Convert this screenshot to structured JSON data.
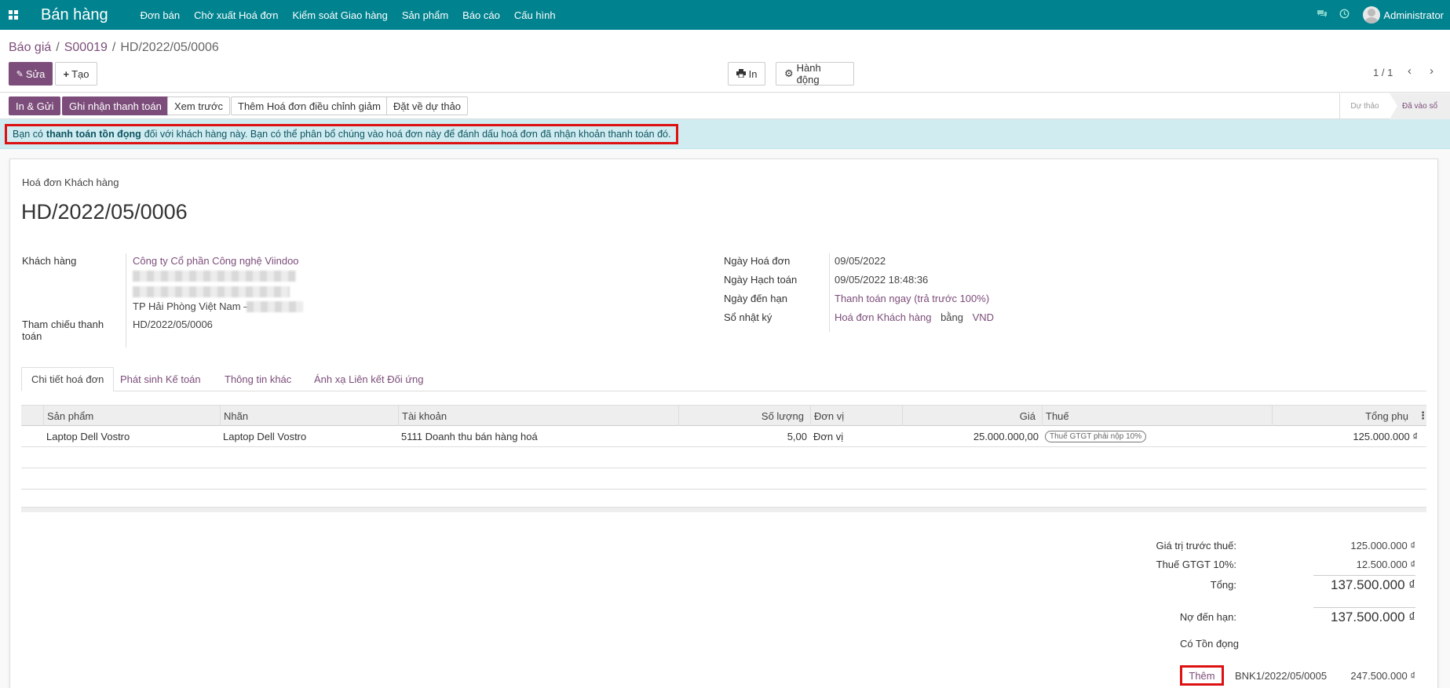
{
  "nav": {
    "brand": "Bán hàng",
    "menu": [
      "Đơn bán",
      "Chờ xuất Hoá đơn",
      "Kiểm soát Giao hàng",
      "Sản phẩm",
      "Báo cáo",
      "Cấu hình"
    ],
    "user": "Administrator"
  },
  "breadcrumb": [
    "Báo giá",
    "S00019",
    "HD/2022/05/0006"
  ],
  "toolbar": {
    "edit": "Sửa",
    "create": "Tạo",
    "print": "In",
    "action": "Hành động",
    "pager": "1 / 1"
  },
  "status_buttons": [
    "In & Gửi",
    "Ghi nhận thanh toán",
    "Xem trước",
    "Thêm Hoá đơn điều chỉnh giảm",
    "Đặt về dự thảo"
  ],
  "stages": {
    "draft": "Dự thảo",
    "posted": "Đã vào sổ"
  },
  "alert": {
    "before": "Bạn có",
    "bold": "thanh toán tồn đọng",
    "after": "đối với khách hàng này. Bạn có thể phân bổ chúng vào hoá đơn này để đánh dấu hoá đơn đã nhận khoản thanh toán đó."
  },
  "invoice": {
    "type": "Hoá đơn Khách hàng",
    "name": "HD/2022/05/0006",
    "customer_label": "Khách hàng",
    "customer": "Công ty Cổ phần Công nghệ Viindoo",
    "address_city": "TP Hải Phòng Việt Nam –",
    "payment_ref_label_1": "Tham chiếu thanh",
    "payment_ref_label_2": "toán",
    "payment_ref": "HD/2022/05/0006",
    "invoice_date_label": "Ngày Hoá đơn",
    "invoice_date": "09/05/2022",
    "accounting_date_label": "Ngày Hạch toán",
    "accounting_date": "09/05/2022 18:48:36",
    "due_date_label": "Ngày đến hạn",
    "due_date": "Thanh toán ngay (trả trước 100%)",
    "journal_label": "Sổ nhật ký",
    "journal": "Hoá đơn Khách hàng",
    "journal_in": "bằng",
    "currency": "VND"
  },
  "tabs": [
    "Chi tiết hoá đơn",
    "Phát sinh Kế toán",
    "Thông tin khác",
    "Ánh xạ Liên kết Đối ứng"
  ],
  "lines": {
    "headers": [
      "Sản phẩm",
      "Nhãn",
      "Tài khoản",
      "Số lượng",
      "Đơn vị",
      "Giá",
      "Thuế",
      "Tổng phụ"
    ],
    "rows": [
      {
        "product": "Laptop Dell Vostro",
        "label": "Laptop Dell Vostro",
        "account": "5111 Doanh thu bán hàng hoá",
        "qty": "5,00",
        "uom": "Đơn vị",
        "price": "25.000.000,00",
        "tax": "Thuế GTGT phải nộp 10%",
        "subtotal": "125.000.000 ₫"
      }
    ]
  },
  "totals": {
    "untaxed_label": "Giá trị trước thuế:",
    "untaxed": "125.000.000 ₫",
    "tax_label": "Thuế GTGT 10%:",
    "tax": "12.500.000 ₫",
    "total_label": "Tổng:",
    "total": "137.500.000 ₫",
    "due_label": "Nợ đến hạn:",
    "due": "137.500.000 ₫",
    "outstanding_label": "Có Tồn đọng",
    "add_label": "Thêm",
    "outstanding_ref": "BNK1/2022/05/0005",
    "outstanding_amount": "247.500.000 ₫"
  }
}
